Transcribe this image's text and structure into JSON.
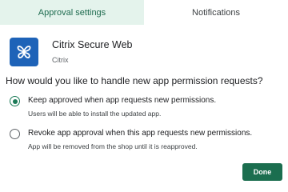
{
  "tabs": [
    {
      "label": "Approval settings",
      "active": true
    },
    {
      "label": "Notifications",
      "active": false
    }
  ],
  "app": {
    "name": "Citrix Secure Web",
    "vendor": "Citrix",
    "icon": "citrix-butterfly-icon",
    "icon_bg": "#1e63b8"
  },
  "question": "How would you like to handle new app permission requests?",
  "options": [
    {
      "label": "Keep approved when app requests new permissions.",
      "description": "Users will be able to install the updated app.",
      "selected": true
    },
    {
      "label": "Revoke app approval when this app requests new permissions.",
      "description": "App will be removed from the shop until it is reapproved.",
      "selected": false
    }
  ],
  "done_label": "Done",
  "colors": {
    "accent": "#1b6e4f",
    "tab_active_bg": "#e4f3ec"
  }
}
